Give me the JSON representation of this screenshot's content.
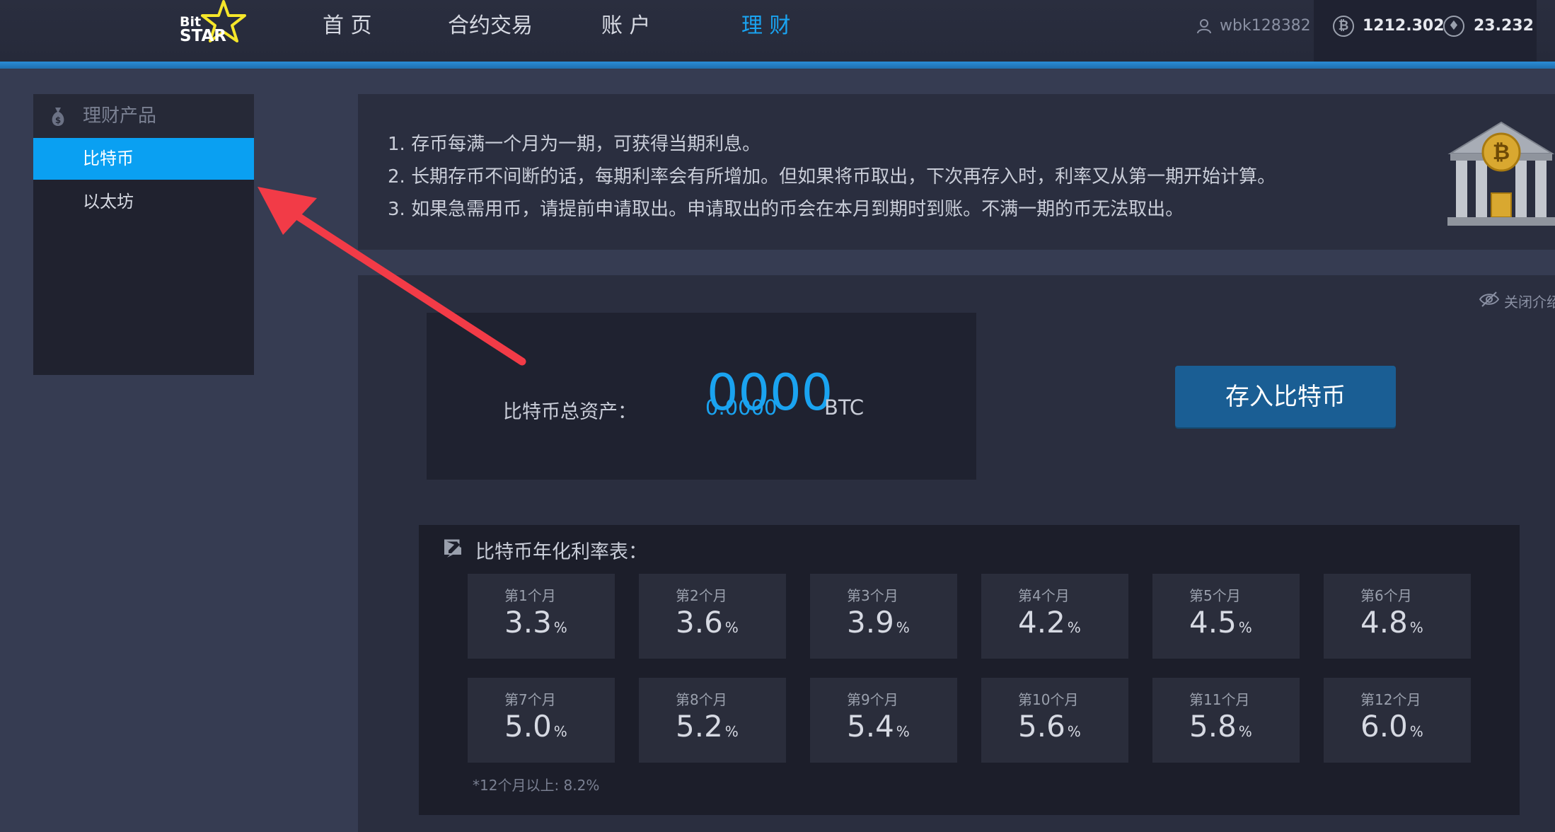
{
  "brand": {
    "line1": "Bit",
    "line2": "STAR"
  },
  "nav": [
    {
      "label": "首 页"
    },
    {
      "label": "合约交易"
    },
    {
      "label": "账 户"
    },
    {
      "label": "理 财"
    }
  ],
  "user": {
    "name": "wbk128382"
  },
  "balances": {
    "btc": "1212.302",
    "eth": "23.232"
  },
  "sidebar": {
    "header": "理财产品",
    "items": [
      {
        "label": "比特币"
      },
      {
        "label": "以太坊"
      }
    ]
  },
  "info": {
    "lines": [
      "1. 存币每满一个月为一期，可获得当期利息。",
      "2. 长期存币不间断的话，每期利率会有所增加。但如果将币取出，下次再存入时，利率又从第一期开始计算。",
      "3. 如果急需用币，请提前申请取出。申请取出的币会在本月到期时到账。不满一期的币无法取出。"
    ]
  },
  "close_intro": "关闭介绍",
  "asset": {
    "label": "比特币总资产：",
    "small": "0.0000",
    "big": "0000",
    "unit": "BTC"
  },
  "deposit_button": "存入比特币",
  "rates": {
    "title": "比特币年化利率表：",
    "unit": "%",
    "items": [
      {
        "month": "第1个月",
        "value": "3.3"
      },
      {
        "month": "第2个月",
        "value": "3.6"
      },
      {
        "month": "第3个月",
        "value": "3.9"
      },
      {
        "month": "第4个月",
        "value": "4.2"
      },
      {
        "month": "第5个月",
        "value": "4.5"
      },
      {
        "month": "第6个月",
        "value": "4.8"
      },
      {
        "month": "第7个月",
        "value": "5.0"
      },
      {
        "month": "第8个月",
        "value": "5.2"
      },
      {
        "month": "第9个月",
        "value": "5.4"
      },
      {
        "month": "第10个月",
        "value": "5.6"
      },
      {
        "month": "第11个月",
        "value": "5.8"
      },
      {
        "month": "第12个月",
        "value": "6.0"
      }
    ],
    "note": "*12个月以上: 8.2%"
  },
  "colors": {
    "accent": "#1aa3f0",
    "button": "#1a5e94",
    "annotation_arrow": "#f23b47"
  }
}
